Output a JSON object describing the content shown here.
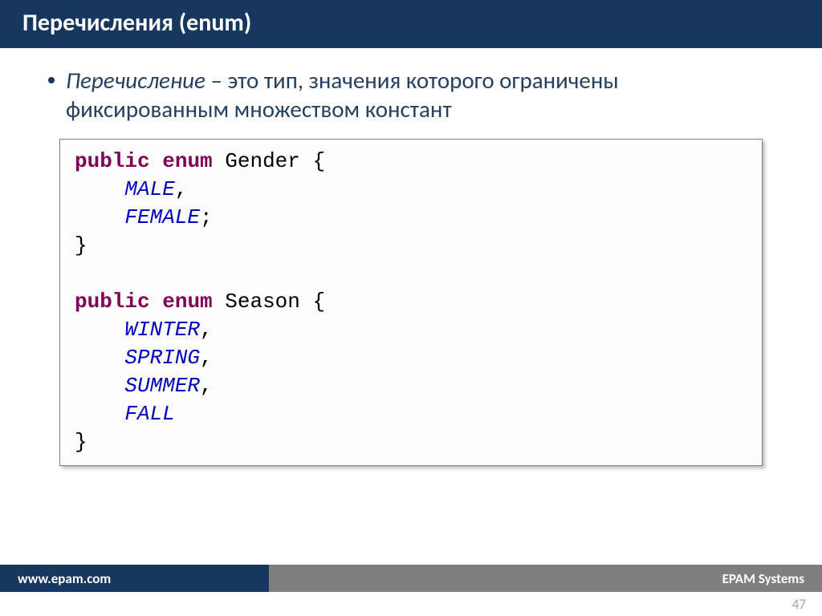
{
  "title": "Перечисления (enum)",
  "bullet": {
    "term": "Перечисление",
    "rest": " – это тип, значения которого ограничены фиксированным множеством констант"
  },
  "code": {
    "kw_public1": "public",
    "kw_enum1": "enum",
    "name1": " Gender {",
    "val_male": "MALE",
    "comma1": ",",
    "val_female": "FEMALE",
    "semi1": ";",
    "close1": "}",
    "kw_public2": "public",
    "kw_enum2": "enum",
    "name2": " Season {",
    "val_winter": "WINTER",
    "comma2": ",",
    "val_spring": "SPRING",
    "comma3": ",",
    "val_summer": "SUMMER",
    "comma4": ",",
    "val_fall": "FALL",
    "close2": "}"
  },
  "footer": {
    "url": "www.epam.com",
    "company": "EPAM Systems"
  },
  "page": "47"
}
